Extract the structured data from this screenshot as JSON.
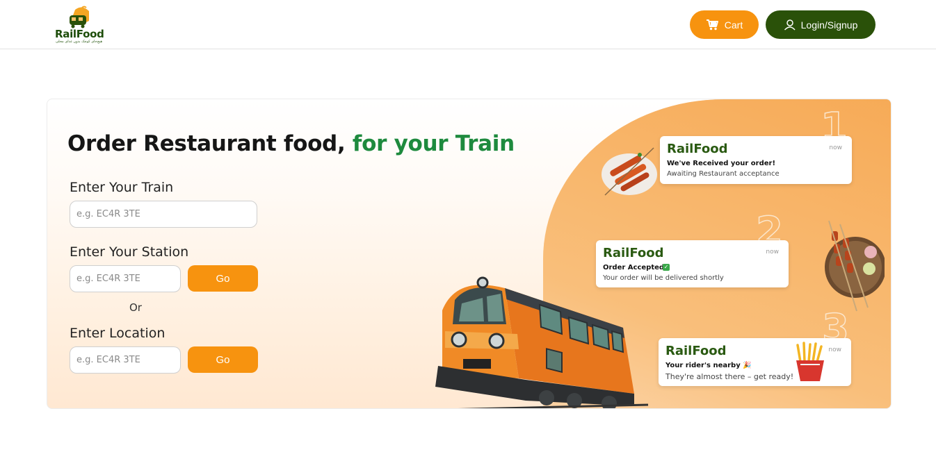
{
  "header": {
    "logo_text": "RailFood",
    "logo_tagline": "هیچ‌جای کوچک بدون غذای محلی",
    "cart_label": "Cart",
    "login_label": "Login/Signup"
  },
  "hero": {
    "title_main": "Order Restaurant food, ",
    "title_accent": "for your Train",
    "train_label": "Enter Your Train",
    "train_placeholder": "e.g. EC4R 3TE",
    "station_label": "Enter Your Station",
    "station_placeholder": "e.g. EC4R 3TE",
    "station_go": "Go",
    "or_text": "Or",
    "location_label": "Enter Location",
    "location_placeholder": "e.g. EC4R 3TE",
    "location_go": "Go"
  },
  "steps": [
    {
      "number": "1",
      "brand": "RailFood",
      "time": "now",
      "line1": "We've Received your order!",
      "line2": "Awaiting Restaurant acceptance"
    },
    {
      "number": "2",
      "brand": "RailFood",
      "time": "now",
      "line1": "Order Accepted!",
      "line2": "Your order will be delivered shortly"
    },
    {
      "number": "3",
      "brand": "RailFood",
      "time": "now",
      "line1": "Your rider's nearby 🎉",
      "line2": "They're almost there – get ready!"
    }
  ],
  "colors": {
    "accent_orange": "#f7930f",
    "brand_green": "#2a5109",
    "title_green": "#1e8a3e"
  },
  "icons": {
    "cart": "cart-icon",
    "user": "user-icon",
    "check": "check-icon"
  }
}
